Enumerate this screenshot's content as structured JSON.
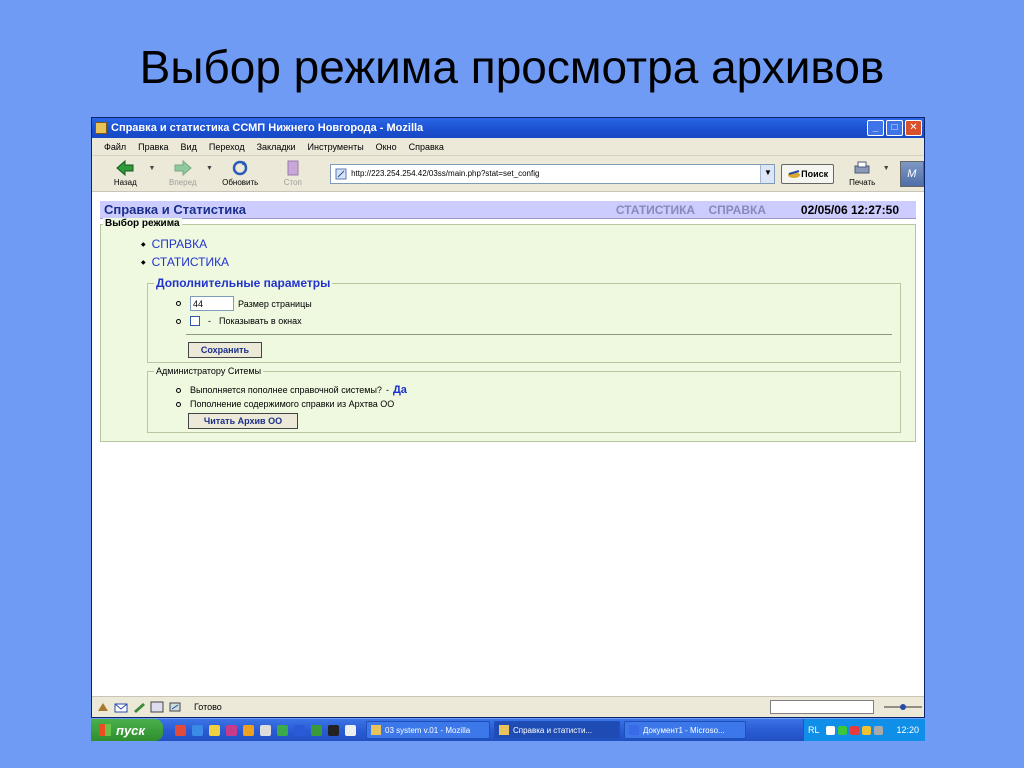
{
  "slide": {
    "title": "Выбор режима просмотра архивов"
  },
  "window": {
    "title": "Справка и статистика ССМП Нижнего Новгорода - Mozilla",
    "controls": {
      "minimize": "_",
      "maximize": "□",
      "close": "✕"
    }
  },
  "menu": [
    "Файл",
    "Правка",
    "Вид",
    "Переход",
    "Закладки",
    "Инструменты",
    "Окно",
    "Справка"
  ],
  "toolbar": {
    "back": "Назад",
    "forward": "Вперед",
    "reload": "Обновить",
    "stop": "Стоп",
    "url": "http://223.254.254.42/03ss/main.php?stat=set_config",
    "search": "Поиск",
    "print": "Печать",
    "logo": "M"
  },
  "page": {
    "site_title": "Справка и Статистика",
    "nav": [
      "СТАТИСТИКА",
      "СПРАВКА"
    ],
    "datetime": "02/05/06  12:27:50",
    "mode_legend": "Выбор режима",
    "modes": [
      "СПРАВКА",
      "СТАТИСТИКА"
    ],
    "extra": {
      "legend": "Дополнительные параметры",
      "page_size_value": "44",
      "page_size_label": "Размер страницы",
      "windows_dash": "-",
      "windows_label": "Показывать в окнах",
      "save": "Сохранить"
    },
    "admin": {
      "legend": "Администратору Ситемы",
      "running_question": "Выполняется пополнее справочной системы?",
      "running_dash": "-",
      "running_answer": "Да",
      "refill_label": "Пополнение содержимого справки из Архтва ОО",
      "read_button": "Читать Архив ОО"
    }
  },
  "status": {
    "text": "Готово"
  },
  "taskbar": {
    "start": "пуск",
    "tasks": [
      "03 system v.01 - Mozilla",
      "Справка и статисти...",
      "Документ1 - Microso..."
    ],
    "lang": "RL",
    "clock": "12:20"
  },
  "colors": {
    "slide_bg": "#6f9bf4",
    "header_bg": "#ccccff",
    "form_bg": "#eef9e0",
    "link": "#2233cc"
  }
}
